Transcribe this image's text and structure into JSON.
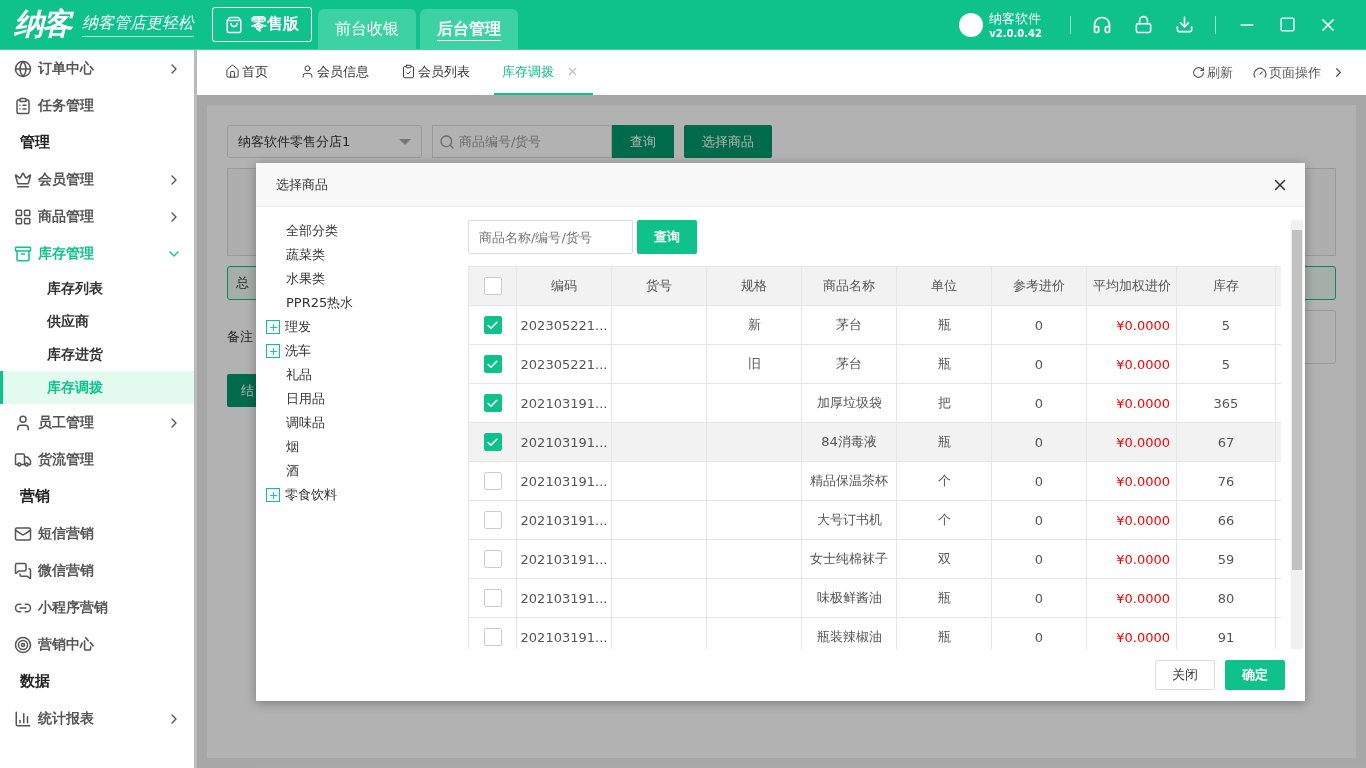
{
  "app": {
    "logo": "纳客",
    "slogan": "纳客管店更轻松",
    "edition": "零售版",
    "user": {
      "name": "纳客软件",
      "version": "v2.0.0.42"
    }
  },
  "nav_tabs": [
    {
      "label": "前台收银",
      "selected": false
    },
    {
      "label": "后台管理",
      "selected": true
    }
  ],
  "sidebar": {
    "items": [
      {
        "kind": "item",
        "label": "订单中心",
        "expanded": false
      },
      {
        "kind": "item",
        "label": "任务管理"
      },
      {
        "kind": "section",
        "label": "管理"
      },
      {
        "kind": "item",
        "label": "会员管理",
        "expanded": false
      },
      {
        "kind": "item",
        "label": "商品管理",
        "expanded": false
      },
      {
        "kind": "item",
        "label": "库存管理",
        "expanded": true,
        "children": [
          {
            "label": "库存列表",
            "selected": false
          },
          {
            "label": "供应商",
            "selected": false
          },
          {
            "label": "库存进货",
            "selected": false
          },
          {
            "label": "库存调拨",
            "selected": true
          }
        ]
      },
      {
        "kind": "item",
        "label": "员工管理",
        "expanded": false
      },
      {
        "kind": "item",
        "label": "货流管理"
      },
      {
        "kind": "section",
        "label": "营销"
      },
      {
        "kind": "item",
        "label": "短信营销"
      },
      {
        "kind": "item",
        "label": "微信营销"
      },
      {
        "kind": "item",
        "label": "小程序营销"
      },
      {
        "kind": "item",
        "label": "营销中心"
      },
      {
        "kind": "section",
        "label": "数据"
      },
      {
        "kind": "item",
        "label": "统计报表",
        "expanded": false
      }
    ]
  },
  "page_tabs": [
    {
      "label": "首页",
      "selected": false
    },
    {
      "label": "会员信息",
      "selected": false
    },
    {
      "label": "会员列表",
      "selected": false
    },
    {
      "label": "库存调拨",
      "selected": true
    }
  ],
  "page_actions": [
    "刷新",
    "页面操作"
  ],
  "background": {
    "store_select": "纳客软件零售分店1",
    "search_placeholder": "商品编号/货号",
    "buttons": [
      "查询",
      "选择商品"
    ],
    "summary": "总",
    "remark_label": "备注",
    "submit": "结"
  },
  "dialog": {
    "title": "选择商品",
    "categories": [
      {
        "kind": "leaf",
        "label": "全部分类"
      },
      {
        "kind": "leaf",
        "label": "蔬菜类"
      },
      {
        "kind": "leaf",
        "label": "水果类"
      },
      {
        "kind": "leaf",
        "label": "PPR25热水"
      },
      {
        "kind": "group",
        "label": "理发",
        "expanded": false
      },
      {
        "kind": "group",
        "label": "洗车",
        "expanded": false
      },
      {
        "kind": "leaf",
        "label": "礼品"
      },
      {
        "kind": "leaf",
        "label": "日用品"
      },
      {
        "kind": "leaf",
        "label": "调味品"
      },
      {
        "kind": "leaf",
        "label": "烟"
      },
      {
        "kind": "leaf",
        "label": "酒"
      },
      {
        "kind": "group",
        "label": "零食饮料",
        "expanded": false
      }
    ],
    "search_placeholder": "商品名称/编号/货号",
    "search_button": "查询",
    "table": {
      "all_checked": false,
      "columns": [
        "编码",
        "货号",
        "规格",
        "商品名称",
        "单位",
        "参考进价",
        "平均加权进价",
        "库存"
      ],
      "rows": [
        {
          "checked": true,
          "hovered": false,
          "cells": [
            "202305221...",
            "",
            "新",
            "茅台",
            "瓶",
            "0",
            "¥0.0000",
            "5"
          ]
        },
        {
          "checked": true,
          "hovered": false,
          "cells": [
            "202305221...",
            "",
            "旧",
            "茅台",
            "瓶",
            "0",
            "¥0.0000",
            "5"
          ]
        },
        {
          "checked": true,
          "hovered": false,
          "cells": [
            "202103191...",
            "",
            "",
            "加厚垃圾袋",
            "把",
            "0",
            "¥0.0000",
            "365"
          ]
        },
        {
          "checked": true,
          "hovered": true,
          "cells": [
            "202103191...",
            "",
            "",
            "84消毒液",
            "瓶",
            "0",
            "¥0.0000",
            "67"
          ]
        },
        {
          "checked": false,
          "hovered": false,
          "cells": [
            "202103191...",
            "",
            "",
            "精品保温茶杯",
            "个",
            "0",
            "¥0.0000",
            "76"
          ]
        },
        {
          "checked": false,
          "hovered": false,
          "cells": [
            "202103191...",
            "",
            "",
            "大号订书机",
            "个",
            "0",
            "¥0.0000",
            "66"
          ]
        },
        {
          "checked": false,
          "hovered": false,
          "cells": [
            "202103191...",
            "",
            "",
            "女士纯棉袜子",
            "双",
            "0",
            "¥0.0000",
            "59"
          ]
        },
        {
          "checked": false,
          "hovered": false,
          "cells": [
            "202103191...",
            "",
            "",
            "味极鲜酱油",
            "瓶",
            "0",
            "¥0.0000",
            "80"
          ]
        },
        {
          "checked": false,
          "hovered": false,
          "cells": [
            "202103191...",
            "",
            "",
            "瓶装辣椒油",
            "瓶",
            "0",
            "¥0.0000",
            "91"
          ]
        }
      ]
    },
    "buttons": [
      {
        "label": "关闭",
        "kind": "secondary"
      },
      {
        "label": "确定",
        "kind": "primary"
      }
    ]
  }
}
